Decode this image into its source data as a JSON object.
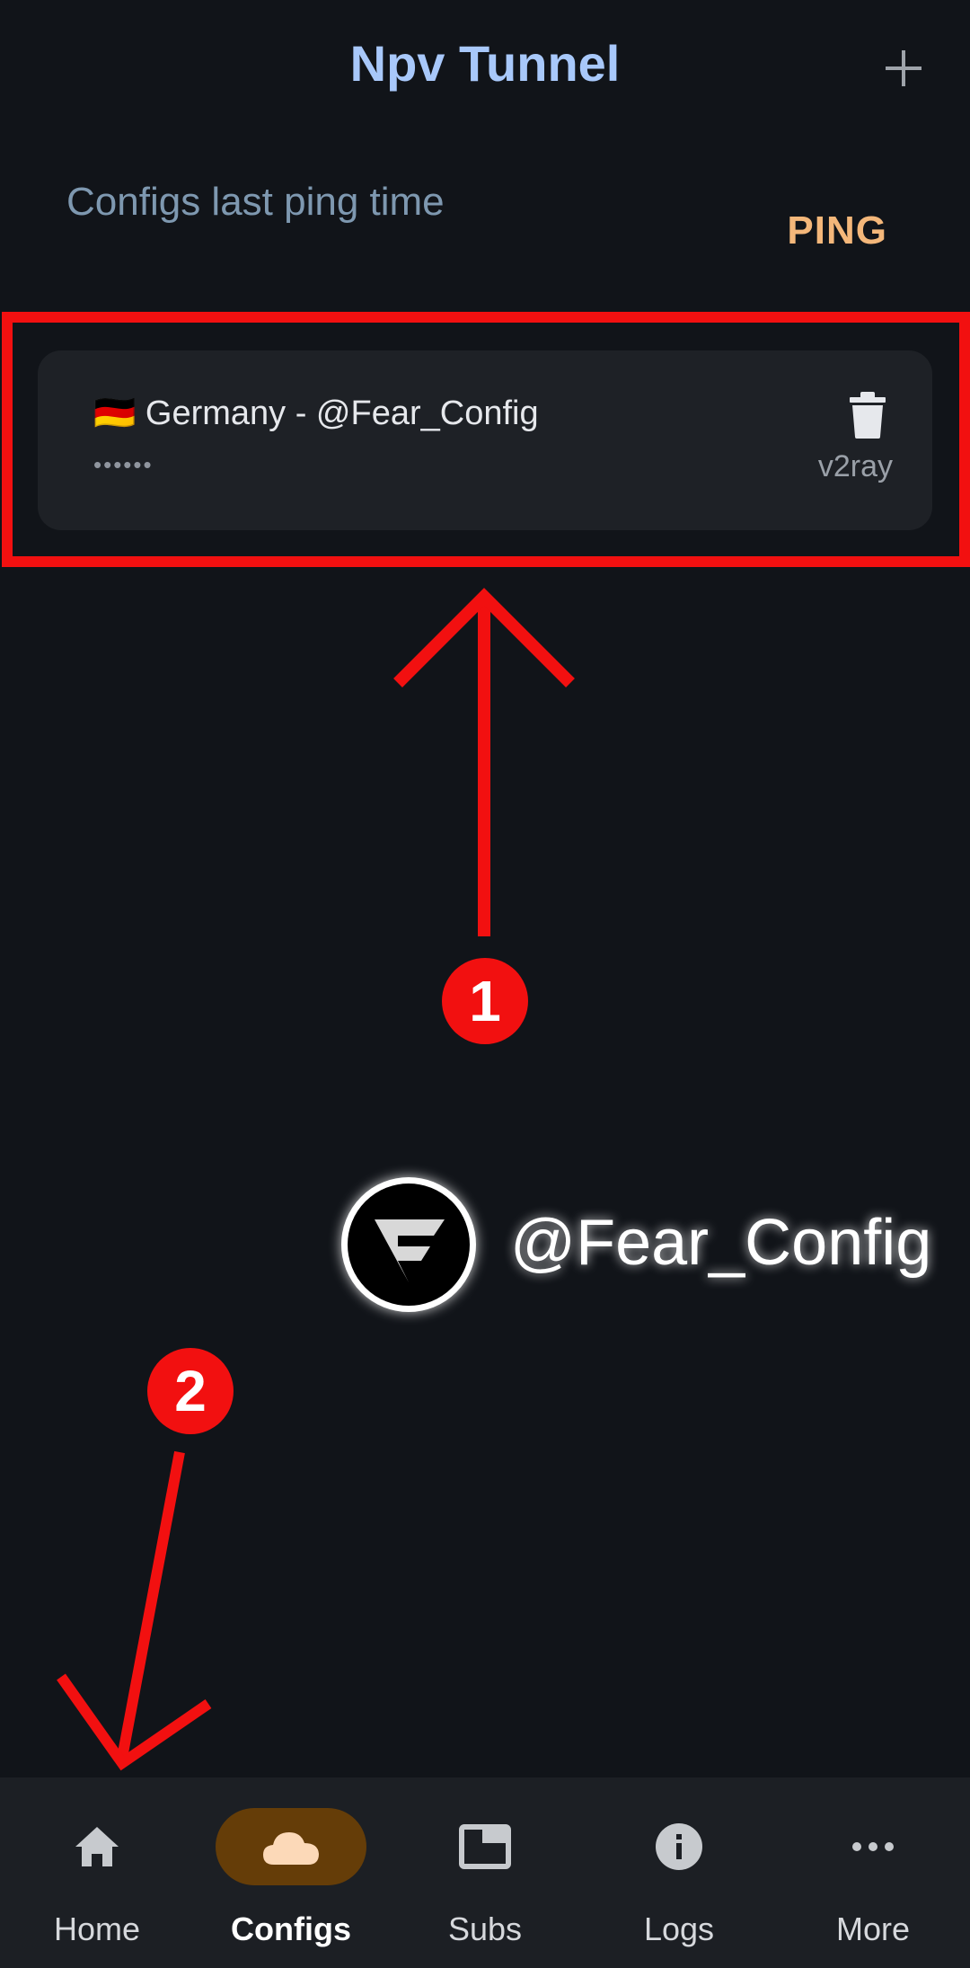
{
  "header": {
    "title": "Npv Tunnel",
    "add_icon": "plus-icon"
  },
  "ping_bar": {
    "caption": "Configs last ping time",
    "ping_label": "PING"
  },
  "configs": [
    {
      "flag": "🇩🇪",
      "name": "Germany - @Fear_Config",
      "ping": "••••••",
      "type": "v2ray",
      "delete_icon": "trash-icon"
    }
  ],
  "annotations": {
    "badge_1": "1",
    "badge_2": "2",
    "color": "#f21010"
  },
  "watermark": {
    "text": "@Fear_Config"
  },
  "bottom_nav": {
    "items": [
      {
        "label": "Home",
        "icon": "home-icon",
        "active": false
      },
      {
        "label": "Configs",
        "icon": "cloud-icon",
        "active": true
      },
      {
        "label": "Subs",
        "icon": "window-icon",
        "active": false
      },
      {
        "label": "Logs",
        "icon": "info-icon",
        "active": false
      },
      {
        "label": "More",
        "icon": "more-dots-icon",
        "active": false
      }
    ]
  },
  "colors": {
    "background": "#111419",
    "title": "#a8c8fa",
    "ping_accent": "#f4b77a",
    "active_pill": "#653d08"
  }
}
